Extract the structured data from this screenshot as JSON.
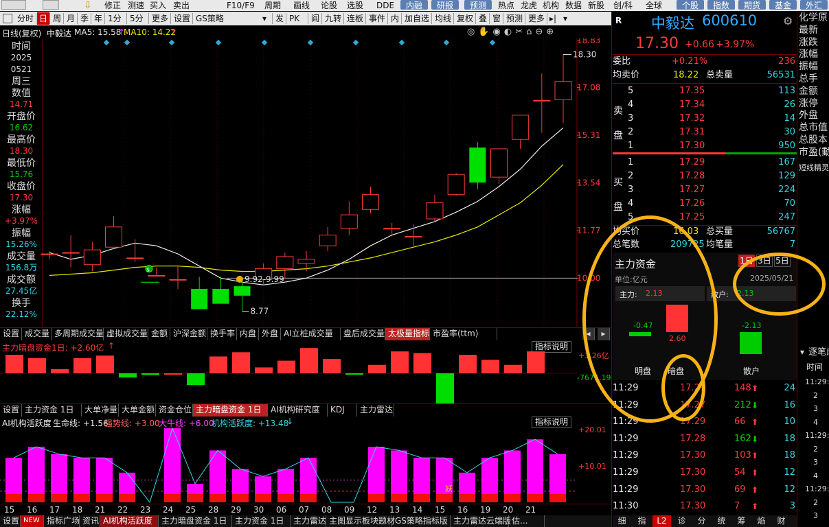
{
  "topbar": {
    "items": [
      "修正",
      "测速",
      "买入",
      "卖出",
      "F10/F9",
      "周期",
      "画线",
      "论股",
      "选股",
      "DDE"
    ],
    "buttons": [
      "内融",
      "研报",
      "预测"
    ],
    "right_items": [
      "热点",
      "龙虎",
      "机构",
      "数据",
      "新股",
      "创/科",
      "全球"
    ],
    "right_buttons": [
      "个股",
      "指数",
      "期货",
      "基金",
      "外汇"
    ]
  },
  "toolbar": {
    "items": [
      "分时",
      "日",
      "周",
      "月",
      "季",
      "年",
      "1分",
      "5分",
      "更多",
      "设置",
      "GS策略",
      "发",
      "PK",
      "阎",
      "九转",
      "连板",
      "事件",
      "内",
      "加自选",
      "均线",
      "复权",
      "叠",
      "窗",
      "预测",
      "更多"
    ],
    "active": "日"
  },
  "chart_header": {
    "mode": "日线(复权)",
    "stock": "中毅达",
    "ma5_label": "MA5: 15.58",
    "ma10_label": "MA10: 14.22"
  },
  "info_panel": [
    {
      "label": "时间",
      "value": "2025",
      "color": "#ddd"
    },
    {
      "label": "",
      "value": "0521",
      "color": "#ddd"
    },
    {
      "label": "周三",
      "value": "",
      "color": "#ddd"
    },
    {
      "label": "数值",
      "value": "14.71",
      "color": "#ff3b3b"
    },
    {
      "label": "开盘价",
      "value": "16.62",
      "color": "#00d000"
    },
    {
      "label": "最高价",
      "value": "18.30",
      "color": "#ff3b3b"
    },
    {
      "label": "最低价",
      "value": "15.76",
      "color": "#00d000"
    },
    {
      "label": "收盘价",
      "value": "17.30",
      "color": "#ff3b3b"
    },
    {
      "label": "涨幅",
      "value": "+3.97%",
      "color": "#ff3b3b"
    },
    {
      "label": "振幅",
      "value": "15.26%",
      "color": "#33d6e0"
    },
    {
      "label": "成交量",
      "value": "156.8万",
      "color": "#33d6e0"
    },
    {
      "label": "成交额",
      "value": "27.45亿",
      "color": "#33d6e0"
    },
    {
      "label": "换手",
      "value": "22.12%",
      "color": "#33d6e0"
    }
  ],
  "chart_data": {
    "type": "candlestick",
    "y_ticks": [
      "18.83",
      "17.08",
      "15.31",
      "13.54",
      "11.77",
      "10.00"
    ],
    "ylim": [
      8.2,
      18.9
    ],
    "high_label": "18.30",
    "low_label": "8.77",
    "range_label": "9.92-9.99",
    "candles": [
      {
        "o": 10.9,
        "c": 10.9,
        "h": 11.0,
        "l": 10.7
      },
      {
        "o": 10.95,
        "c": 10.95,
        "h": 11.6,
        "l": 10.4
      },
      {
        "o": 10.5,
        "c": 11.05,
        "h": 11.35,
        "l": 10.25
      },
      {
        "o": 11.15,
        "c": 11.9,
        "h": 12.3,
        "l": 11.15
      },
      {
        "o": 10.75,
        "c": 10.75,
        "h": 11.45,
        "l": 10.6
      },
      {
        "o": 10.1,
        "c": 10.1,
        "h": 10.4,
        "l": 10.1
      },
      {
        "o": 9.95,
        "c": 9.95,
        "h": 10.45,
        "l": 9.6
      },
      {
        "o": 9.6,
        "c": 8.85,
        "h": 10.05,
        "l": 8.85
      },
      {
        "o": 9.6,
        "c": 9.05,
        "h": 10.05,
        "l": 9.05
      },
      {
        "o": 9.7,
        "c": 9.35,
        "h": 9.95,
        "l": 8.77
      },
      {
        "o": 9.95,
        "c": 10.35,
        "h": 10.55,
        "l": 9.75
      },
      {
        "o": 10.35,
        "c": 10.8,
        "h": 10.95,
        "l": 10.0
      },
      {
        "o": 10.55,
        "c": 10.7,
        "h": 11.0,
        "l": 10.25
      },
      {
        "o": 11.2,
        "c": 11.6,
        "h": 11.9,
        "l": 11.0
      },
      {
        "o": 11.85,
        "c": 12.35,
        "h": 12.85,
        "l": 11.6
      },
      {
        "o": 12.55,
        "c": 13.1,
        "h": 13.4,
        "l": 12.4
      },
      {
        "o": 11.85,
        "c": 11.85,
        "h": 12.05,
        "l": 11.55
      },
      {
        "o": 11.55,
        "c": 11.55,
        "h": 12.0,
        "l": 11.2
      },
      {
        "o": 12.2,
        "c": 12.8,
        "h": 13.1,
        "l": 12.1
      },
      {
        "o": 13.1,
        "c": 13.85,
        "h": 13.9,
        "l": 13.05
      },
      {
        "o": 14.85,
        "c": 13.55,
        "h": 15.05,
        "l": 13.3
      },
      {
        "o": 13.75,
        "c": 14.8,
        "h": 14.8,
        "l": 13.5
      },
      {
        "o": 15.15,
        "c": 16.05,
        "h": 16.05,
        "l": 14.8
      },
      {
        "o": 16.6,
        "c": 16.6,
        "h": 17.6,
        "l": 15.4
      },
      {
        "o": 16.62,
        "c": 17.3,
        "h": 18.3,
        "l": 15.76
      }
    ],
    "ma5": [
      10.95,
      10.7,
      10.85,
      11.1,
      11.3,
      11.2,
      10.9,
      10.45,
      10.0,
      9.85,
      9.75,
      9.85,
      10.0,
      10.3,
      10.7,
      11.2,
      11.6,
      11.85,
      12.1,
      12.45,
      12.85,
      13.4,
      14.05,
      14.9,
      15.58
    ],
    "ma10": [
      10.1,
      10.15,
      10.2,
      10.3,
      10.4,
      10.45,
      10.45,
      10.4,
      10.3,
      10.25,
      10.25,
      10.3,
      10.35,
      10.45,
      10.6,
      10.75,
      10.95,
      11.15,
      11.35,
      11.6,
      11.9,
      12.35,
      12.8,
      13.45,
      14.22
    ]
  },
  "tabs1": [
    "设置",
    "成交量",
    "多周期成交量",
    "虚拟成交量",
    "金额",
    "沪深金额",
    "换手率",
    "内盘",
    "外盘",
    "AI立桩成交量",
    "盘后成交量",
    "太极量指标",
    "市盈率(ttm)"
  ],
  "tabs1_active": "太极量指标",
  "indicator1": {
    "title": "主力暗盘资金1日: +2.60亿",
    "btn": "指标说明",
    "scale_top": "+3.26亿",
    "scale_bottom": "-7675.19",
    "values": [
      2.2,
      1.8,
      0.5,
      1.8,
      2.1,
      -0.5,
      -0.2,
      0.0,
      -1.4,
      2.0,
      2.5,
      0.7,
      1.5,
      3.0,
      1.7,
      -0.1,
      1.0,
      2.6,
      2.4,
      -4.5,
      2.2,
      1.6,
      1.0,
      2.6
    ],
    "bar_min": -5,
    "bar_max": 3.26
  },
  "tabs2": [
    "设置",
    "主力资金 1日",
    "大单净量",
    "大单金额",
    "资金仓位",
    "主力暗盘资金 1日",
    "AI机构研究度",
    "KDJ",
    "主力雷达"
  ],
  "tabs2_active": "主力暗盘资金 1日",
  "indicator2": {
    "title": "AI机构活跃度",
    "life_label": "生命线: +1.56",
    "strong_label": "强势线: +3.00",
    "bull_label": "大牛线: +6.00",
    "active_label": "机构活跃度: +13.48",
    "btn": "指标说明",
    "scale_top": "+20.01",
    "scale_mid": "+10.01",
    "bars": [
      12,
      15,
      13,
      12,
      12,
      8,
      0,
      20,
      5,
      14,
      9,
      7,
      9,
      12,
      0,
      0,
      15,
      14,
      12,
      12,
      8,
      12,
      14,
      17,
      13
    ],
    "ymax": 20.01,
    "yao_label": "妖"
  },
  "x_dates": [
    "15",
    "16",
    "17",
    "18",
    "21",
    "22",
    "23",
    "24",
    "25",
    "28",
    "29",
    "30",
    "06",
    "07",
    "08",
    "09",
    "12",
    "13",
    "14",
    "15",
    "16",
    "19",
    "20",
    "21"
  ],
  "bottom_tabs": [
    "设置",
    "NEW",
    "指标广场",
    "资讯",
    "AI机构活跃度",
    "主力暗盘资金 1日",
    "主力资金 1日",
    "主力雷达",
    "主图显示板块题材",
    "GS策略指标版",
    "主力雷达云端版",
    "估..."
  ],
  "bottom_tabs_active": "AI机构活跃度",
  "quote": {
    "name": "中毅达",
    "code": "600610",
    "price": "17.30",
    "change": "+0.66",
    "pct": "+3.97%",
    "wb_label": "委比",
    "wb_val": "+0.21%",
    "wb_num": "236",
    "avg_sell_label": "均卖价",
    "avg_sell": "18.22",
    "total_sell_label": "总卖量",
    "total_sell": "56531",
    "sell_side": "卖盘",
    "buy_side": "买盘",
    "sells": [
      {
        "lvl": "5",
        "price": "17.35",
        "vol": "113"
      },
      {
        "lvl": "4",
        "price": "17.34",
        "vol": "26"
      },
      {
        "lvl": "3",
        "price": "17.32",
        "vol": "14"
      },
      {
        "lvl": "2",
        "price": "17.31",
        "vol": "30"
      },
      {
        "lvl": "1",
        "price": "17.30",
        "vol": "950"
      }
    ],
    "buys": [
      {
        "lvl": "1",
        "price": "17.29",
        "vol": "167"
      },
      {
        "lvl": "2",
        "price": "17.28",
        "vol": "129"
      },
      {
        "lvl": "3",
        "price": "17.27",
        "vol": "224"
      },
      {
        "lvl": "4",
        "price": "17.26",
        "vol": "70"
      },
      {
        "lvl": "5",
        "price": "17.25",
        "vol": "247"
      }
    ],
    "avg_buy_label": "均买价",
    "avg_buy": "16.03",
    "total_buy_label": "总买量",
    "total_buy": "56767",
    "total_cnt_label": "总笔数",
    "total_cnt": "209725",
    "avg_qty_label": "均笔量",
    "avg_qty": "7"
  },
  "fund": {
    "title": "主力资金",
    "periods": [
      "1日",
      "3日",
      "5日"
    ],
    "unit": "单位:亿元",
    "date": "2025/05/21",
    "main_label": "主力:",
    "main_val": "2.13",
    "retail_label": "散户:",
    "retail_val": "2.13",
    "bar_open": "-0.47",
    "bar_dark": "2.60",
    "bar_retail": "-2.13",
    "cat_open": "明盘",
    "cat_dark": "暗盘",
    "cat_retail": "散户"
  },
  "ticks": [
    {
      "t": "11:29",
      "p": "17.29",
      "v": "148",
      "d": "up",
      "n": "24"
    },
    {
      "t": "11:29",
      "p": "17.27",
      "v": "212",
      "d": "down",
      "n": "16"
    },
    {
      "t": "11:29",
      "p": "17.29",
      "v": "66",
      "d": "up",
      "n": "10"
    },
    {
      "t": "11:29",
      "p": "17.28",
      "v": "162",
      "d": "down",
      "n": "18"
    },
    {
      "t": "11:29",
      "p": "17.30",
      "v": "103",
      "d": "up",
      "n": "18"
    },
    {
      "t": "11:29",
      "p": "17.30",
      "v": "54",
      "d": "up",
      "n": "12"
    },
    {
      "t": "11:29",
      "p": "17.30",
      "v": "69",
      "d": "up",
      "n": "12"
    },
    {
      "t": "11:30",
      "p": "17.30",
      "v": "7",
      "d": "up",
      "n": "3"
    }
  ],
  "right_bottom_tabs": [
    "细",
    "指",
    "L2",
    "诊",
    "分",
    "统",
    "筹",
    "焰",
    "财"
  ],
  "far_right": {
    "items": [
      "化学原",
      "最新",
      "涨跌",
      "涨幅",
      "振幅",
      "总手",
      "金额",
      "涨停",
      "外盘",
      "总市值",
      "总股本",
      "市盈(動"
    ],
    "small": "短线精灵",
    "panel_title": "逐笔成",
    "time_label": "时间",
    "entries": [
      "11:29:5",
      "2",
      "3",
      "4",
      "11:29:5",
      "2",
      "3",
      "4",
      "11:29:5",
      "2",
      "3"
    ]
  }
}
